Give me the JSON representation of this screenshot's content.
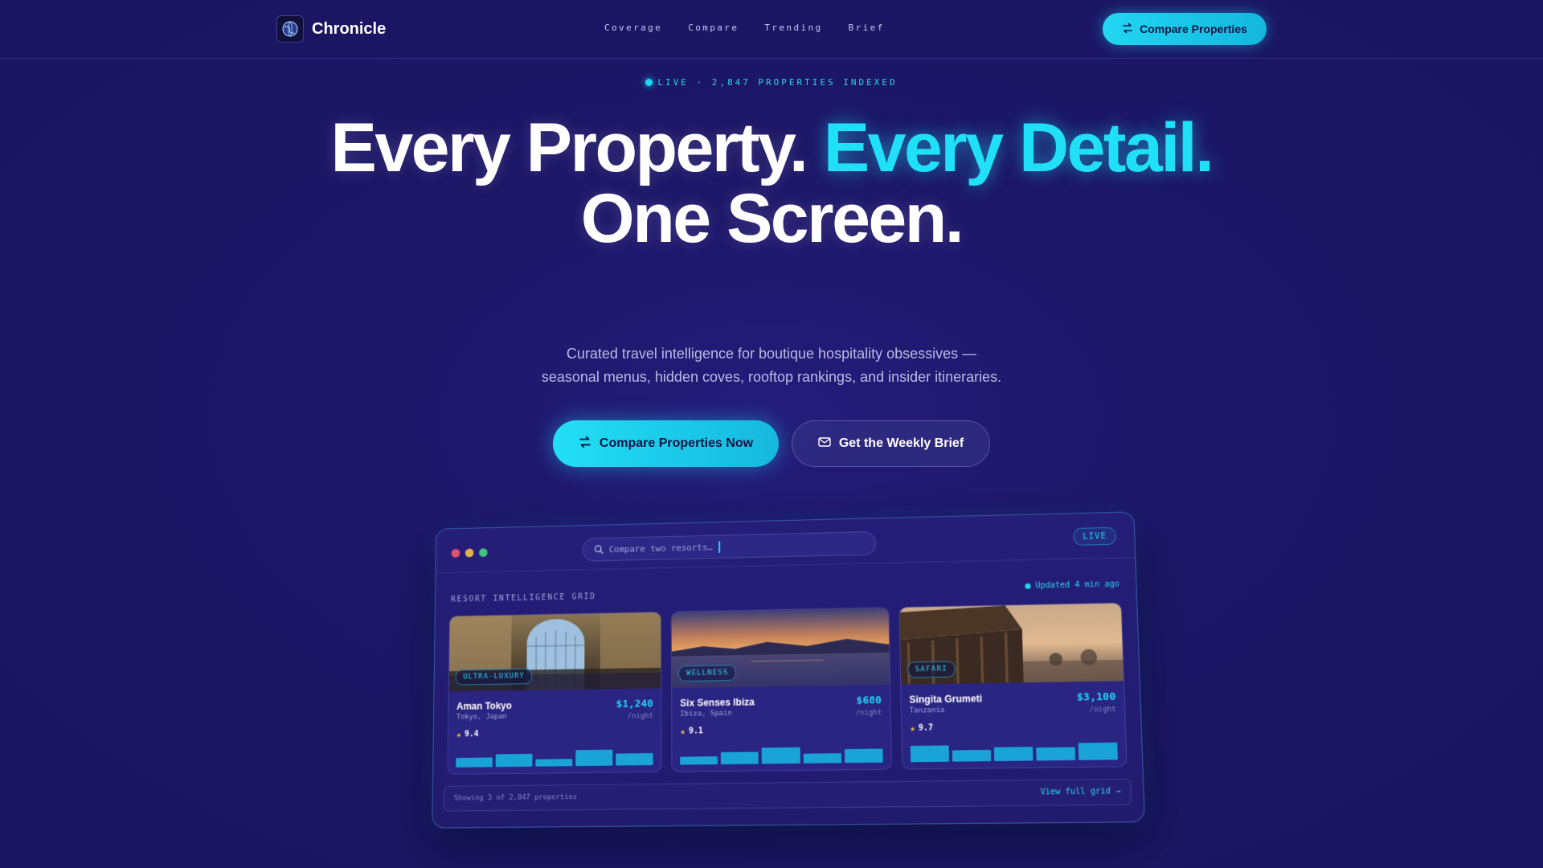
{
  "nav": {
    "brand": "Chronicle",
    "logo_icon": "globe-logo-icon",
    "links": [
      "Coverage",
      "Compare",
      "Trending",
      "Brief"
    ],
    "cta_label": "Compare Properties",
    "cta_icon": "swap-arrows-icon"
  },
  "hero": {
    "live_text": "LIVE · 2,847 PROPERTIES INDEXED",
    "headline_1": "Every Property.",
    "headline_2": "Every Detail.",
    "headline_3": "One Screen.",
    "subtitle_line_1": "Curated travel intelligence for boutique hospitality obsessives —",
    "subtitle_line_2": "seasonal menus, hidden coves, rooftop rankings, and insider itineraries.",
    "primary_cta": "Compare Properties Now",
    "secondary_cta": "Get the Weekly Brief"
  },
  "colors": {
    "background": "#1d1764",
    "accent": "#22d6f2",
    "text": "#ffffff",
    "muted": "#b9bce4"
  },
  "dashboard": {
    "search_placeholder": "Compare two resorts…",
    "live_badge": "LIVE",
    "grid_label": "RESORT INTELLIGENCE GRID",
    "updated": "Updated 4 min ago",
    "cards": [
      {
        "tag": "ULTRA-LUXURY",
        "name": "Aman Tokyo",
        "location": "Tokyo, Japan",
        "price": "$1,240",
        "per_night": "/night",
        "rating": "9.4",
        "bars": [
          0.5,
          0.68,
          0.38,
          0.82,
          0.62
        ]
      },
      {
        "tag": "WELLNESS",
        "name": "Six Senses Ibiza",
        "location": "Ibiza, Spain",
        "price": "$680",
        "per_night": "/night",
        "rating": "9.1",
        "bars": [
          0.42,
          0.62,
          0.82,
          0.48,
          0.72
        ]
      },
      {
        "tag": "SAFARI",
        "name": "Singita Grumeti",
        "location": "Tanzania",
        "price": "$3,100",
        "per_night": "/night",
        "rating": "9.7",
        "bars": [
          0.82,
          0.6,
          0.7,
          0.66,
          0.86
        ]
      }
    ],
    "footer_left": "Showing 3 of 2,847 properties",
    "footer_right": "View full grid →"
  }
}
